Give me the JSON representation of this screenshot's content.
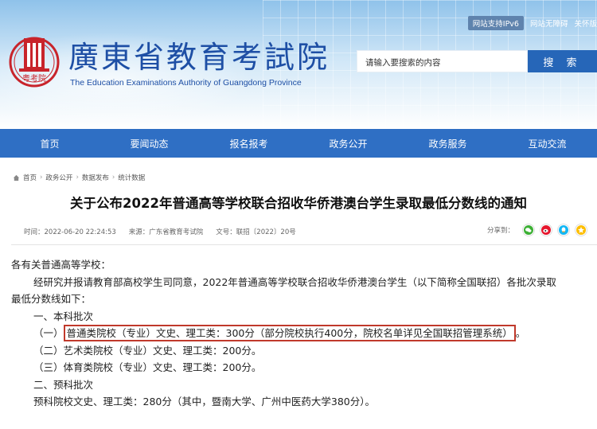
{
  "header": {
    "site_title": "廣東省教育考試院",
    "site_subtitle": "The Education Examinations Authority of Guangdong Province",
    "logo_text": "粤考院",
    "top_links": [
      "网站支持IPv6",
      "网站无障碍",
      "关怀版"
    ],
    "search_placeholder": "请输入要搜索的内容",
    "search_button": "搜 索",
    "colors": {
      "nav": "#2f6fc4",
      "title": "#1e4fa5",
      "logo_red": "#c8242b",
      "highlight_border": "#c0392b"
    }
  },
  "nav": [
    "首页",
    "要闻动态",
    "报名报考",
    "政务公开",
    "政务服务",
    "互动交流"
  ],
  "breadcrumb": [
    "首页",
    "政务公开",
    "数据发布",
    "统计数据"
  ],
  "article": {
    "title": "关于公布2022年普通高等学校联合招收华侨港澳台学生录取最低分数线的通知",
    "time": "时间：2022-06-20 22:24:53",
    "source": "来源：广东省教育考试院",
    "doc_no": "文号：联招〔2022〕20号",
    "share_label": "分享到：",
    "share_icons": [
      "wechat-icon",
      "weibo-icon",
      "qq-icon",
      "qzone-icon"
    ],
    "body": {
      "greeting": "各有关普通高等学校：",
      "p1_line1": "经研究并报请教育部高校学生司同意，2022年普通高等学校联合招收华侨港澳台学生（以下简称全国联招）各批次录取",
      "p1_line2": "最低分数线如下：",
      "s1": "一、本科批次",
      "s1_1_prefix": "（一）",
      "s1_1_highlight": "普通类院校（专业）文史、理工类：300分（部分院校执行400分，院校名单详见全国联招管理系统）",
      "s1_1_suffix": "。",
      "s1_2": "（二）艺术类院校（专业）文史、理工类：200分。",
      "s1_3": "（三）体育类院校（专业）文史、理工类：200分。",
      "s2": "二、预科批次",
      "s2_1": "预科院校文史、理工类：280分（其中，暨南大学、广州中医药大学380分）。"
    }
  }
}
